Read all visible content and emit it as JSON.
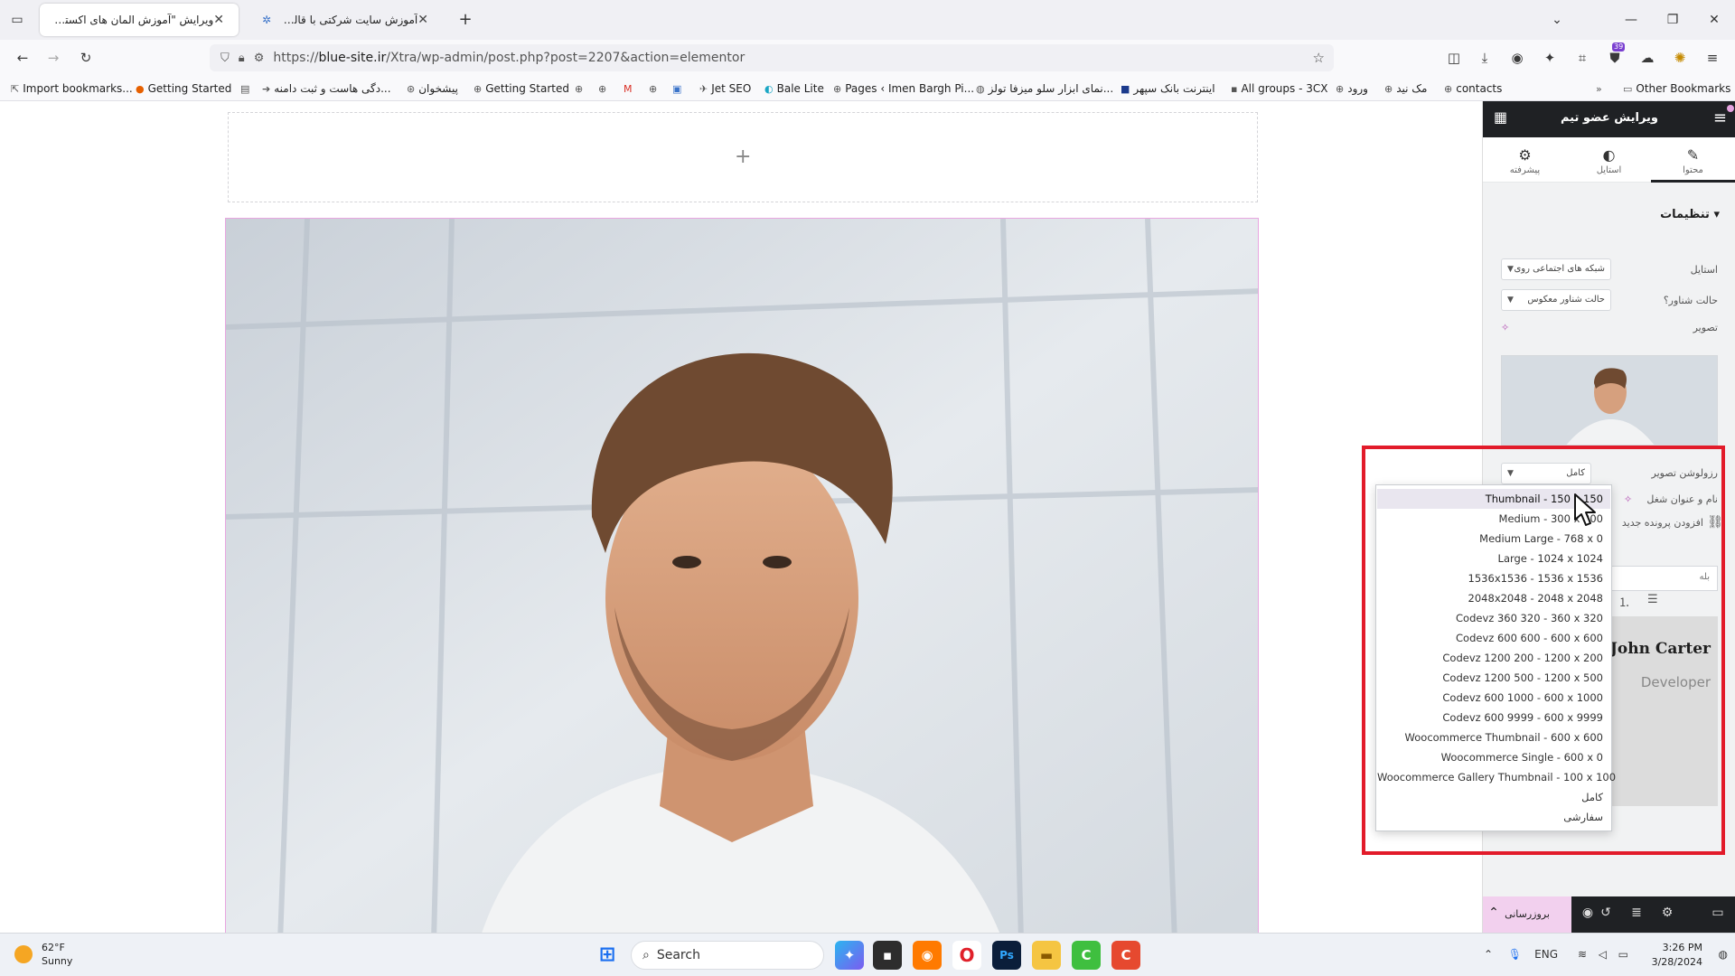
{
  "browser": {
    "tabs": [
      {
        "title": "ویرایش \"آموزش المان های اکسترا –",
        "active": true
      },
      {
        "title": "آموزش سایت شرکتی با قالب اکس",
        "active": false
      }
    ],
    "url_prefix": "https://",
    "url_domain": "blue-site.ir",
    "url_path": "/Xtra/wp-admin/post.php?post=2207&action=elementor",
    "extension_badge": "39",
    "bookmarks": [
      "Import bookmarks...",
      "Getting Started",
      "دگی هاست و ثبت دامنه...",
      "پیشخوان",
      "Getting Started",
      "Jet SEO",
      "Bale Lite",
      "Pages ‹ Imen Bargh Pi...",
      "نمای ابزار سلو میزفا تولز...",
      "اینترنت بانک سپهر",
      "All groups - 3CX",
      "ورود",
      "مک نید",
      "contacts"
    ],
    "other_bookmarks": "Other Bookmarks"
  },
  "panel": {
    "header_title": "ویرایش عضو تیم",
    "tabs": [
      {
        "label": "محتوا",
        "icon": "pencil-icon"
      },
      {
        "label": "استایل",
        "icon": "half-circle-icon"
      },
      {
        "label": "پیشرفته",
        "icon": "gear-icon"
      }
    ],
    "section_title": "تنظیمات",
    "controls": {
      "style_label": "استایل",
      "style_value": "شبکه های اجتماعی روی",
      "float_label": "حالت شناور؟",
      "float_value": "حالت شناور معکوس",
      "image_label": "تصویر",
      "resolution_label": "رزولوشن تصویر",
      "resolution_value": "کامل",
      "name_label": "نام و عنوان شغل",
      "add_field_label": "افزودن پرونده جدید",
      "text_placeholder": "بله"
    },
    "preview": {
      "name": "John Carter",
      "role": "Developer"
    },
    "footer": {
      "update_label": "بروزرسانی"
    }
  },
  "dropdown": {
    "highlighted_index": 0,
    "options": [
      "Thumbnail - 150 x 150",
      "Medium - 300 x 300",
      "Medium Large - 768 x 0",
      "Large - 1024 x 1024",
      "1536x1536 - 1536 x 1536",
      "2048x2048 - 2048 x 2048",
      "Codevz 360 320 - 360 x 320",
      "Codevz 600 600 - 600 x 600",
      "Codevz 1200 200 - 1200 x 200",
      "Codevz 1200 500 - 1200 x 500",
      "Codevz 600 1000 - 600 x 1000",
      "Codevz 600 9999 - 600 x 9999",
      "Woocommerce Thumbnail - 600 x 600",
      "Woocommerce Single - 600 x 0",
      "Woocommerce Gallery Thumbnail - 100 x 100",
      "کامل",
      "سفارشی"
    ]
  },
  "taskbar": {
    "weather_temp": "62°F",
    "weather_desc": "Sunny",
    "search_label": "Search",
    "language": "ENG",
    "time": "3:26 PM",
    "date": "3/28/2024"
  },
  "colors": {
    "accent": "#e21b2a",
    "elementor_dark": "#1f2124",
    "update_pink": "#f2d0ee"
  }
}
